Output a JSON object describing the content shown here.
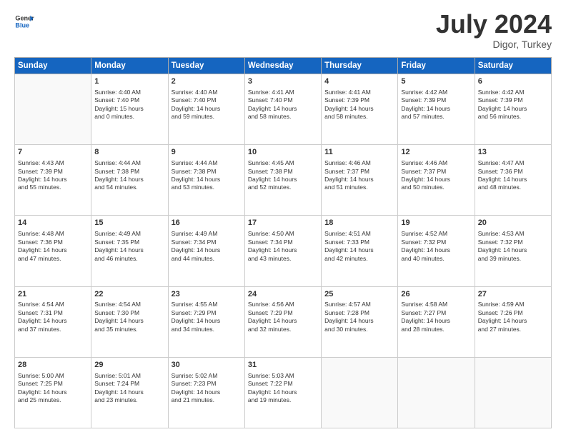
{
  "header": {
    "logo_line1": "General",
    "logo_line2": "Blue",
    "month": "July 2024",
    "location": "Digor, Turkey"
  },
  "weekdays": [
    "Sunday",
    "Monday",
    "Tuesday",
    "Wednesday",
    "Thursday",
    "Friday",
    "Saturday"
  ],
  "weeks": [
    [
      {
        "day": "",
        "info": ""
      },
      {
        "day": "1",
        "info": "Sunrise: 4:40 AM\nSunset: 7:40 PM\nDaylight: 15 hours\nand 0 minutes."
      },
      {
        "day": "2",
        "info": "Sunrise: 4:40 AM\nSunset: 7:40 PM\nDaylight: 14 hours\nand 59 minutes."
      },
      {
        "day": "3",
        "info": "Sunrise: 4:41 AM\nSunset: 7:40 PM\nDaylight: 14 hours\nand 58 minutes."
      },
      {
        "day": "4",
        "info": "Sunrise: 4:41 AM\nSunset: 7:39 PM\nDaylight: 14 hours\nand 58 minutes."
      },
      {
        "day": "5",
        "info": "Sunrise: 4:42 AM\nSunset: 7:39 PM\nDaylight: 14 hours\nand 57 minutes."
      },
      {
        "day": "6",
        "info": "Sunrise: 4:42 AM\nSunset: 7:39 PM\nDaylight: 14 hours\nand 56 minutes."
      }
    ],
    [
      {
        "day": "7",
        "info": "Sunrise: 4:43 AM\nSunset: 7:39 PM\nDaylight: 14 hours\nand 55 minutes."
      },
      {
        "day": "8",
        "info": "Sunrise: 4:44 AM\nSunset: 7:38 PM\nDaylight: 14 hours\nand 54 minutes."
      },
      {
        "day": "9",
        "info": "Sunrise: 4:44 AM\nSunset: 7:38 PM\nDaylight: 14 hours\nand 53 minutes."
      },
      {
        "day": "10",
        "info": "Sunrise: 4:45 AM\nSunset: 7:38 PM\nDaylight: 14 hours\nand 52 minutes."
      },
      {
        "day": "11",
        "info": "Sunrise: 4:46 AM\nSunset: 7:37 PM\nDaylight: 14 hours\nand 51 minutes."
      },
      {
        "day": "12",
        "info": "Sunrise: 4:46 AM\nSunset: 7:37 PM\nDaylight: 14 hours\nand 50 minutes."
      },
      {
        "day": "13",
        "info": "Sunrise: 4:47 AM\nSunset: 7:36 PM\nDaylight: 14 hours\nand 48 minutes."
      }
    ],
    [
      {
        "day": "14",
        "info": "Sunrise: 4:48 AM\nSunset: 7:36 PM\nDaylight: 14 hours\nand 47 minutes."
      },
      {
        "day": "15",
        "info": "Sunrise: 4:49 AM\nSunset: 7:35 PM\nDaylight: 14 hours\nand 46 minutes."
      },
      {
        "day": "16",
        "info": "Sunrise: 4:49 AM\nSunset: 7:34 PM\nDaylight: 14 hours\nand 44 minutes."
      },
      {
        "day": "17",
        "info": "Sunrise: 4:50 AM\nSunset: 7:34 PM\nDaylight: 14 hours\nand 43 minutes."
      },
      {
        "day": "18",
        "info": "Sunrise: 4:51 AM\nSunset: 7:33 PM\nDaylight: 14 hours\nand 42 minutes."
      },
      {
        "day": "19",
        "info": "Sunrise: 4:52 AM\nSunset: 7:32 PM\nDaylight: 14 hours\nand 40 minutes."
      },
      {
        "day": "20",
        "info": "Sunrise: 4:53 AM\nSunset: 7:32 PM\nDaylight: 14 hours\nand 39 minutes."
      }
    ],
    [
      {
        "day": "21",
        "info": "Sunrise: 4:54 AM\nSunset: 7:31 PM\nDaylight: 14 hours\nand 37 minutes."
      },
      {
        "day": "22",
        "info": "Sunrise: 4:54 AM\nSunset: 7:30 PM\nDaylight: 14 hours\nand 35 minutes."
      },
      {
        "day": "23",
        "info": "Sunrise: 4:55 AM\nSunset: 7:29 PM\nDaylight: 14 hours\nand 34 minutes."
      },
      {
        "day": "24",
        "info": "Sunrise: 4:56 AM\nSunset: 7:29 PM\nDaylight: 14 hours\nand 32 minutes."
      },
      {
        "day": "25",
        "info": "Sunrise: 4:57 AM\nSunset: 7:28 PM\nDaylight: 14 hours\nand 30 minutes."
      },
      {
        "day": "26",
        "info": "Sunrise: 4:58 AM\nSunset: 7:27 PM\nDaylight: 14 hours\nand 28 minutes."
      },
      {
        "day": "27",
        "info": "Sunrise: 4:59 AM\nSunset: 7:26 PM\nDaylight: 14 hours\nand 27 minutes."
      }
    ],
    [
      {
        "day": "28",
        "info": "Sunrise: 5:00 AM\nSunset: 7:25 PM\nDaylight: 14 hours\nand 25 minutes."
      },
      {
        "day": "29",
        "info": "Sunrise: 5:01 AM\nSunset: 7:24 PM\nDaylight: 14 hours\nand 23 minutes."
      },
      {
        "day": "30",
        "info": "Sunrise: 5:02 AM\nSunset: 7:23 PM\nDaylight: 14 hours\nand 21 minutes."
      },
      {
        "day": "31",
        "info": "Sunrise: 5:03 AM\nSunset: 7:22 PM\nDaylight: 14 hours\nand 19 minutes."
      },
      {
        "day": "",
        "info": ""
      },
      {
        "day": "",
        "info": ""
      },
      {
        "day": "",
        "info": ""
      }
    ]
  ]
}
